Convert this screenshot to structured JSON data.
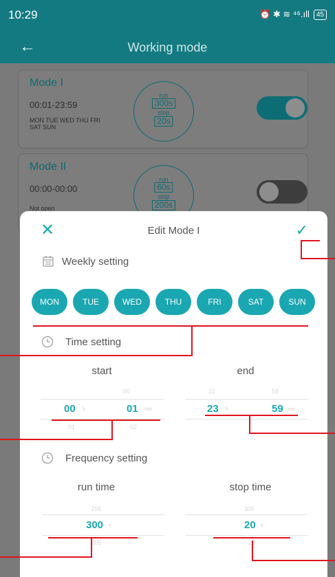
{
  "status_bar": {
    "time": "10:29",
    "icons": "⏰ ✱ ≋ ⁴⁶.ıll",
    "battery": "45"
  },
  "app_bar": {
    "title": "Working mode"
  },
  "modes": [
    {
      "name": "Mode I",
      "time": "00:01-23:59",
      "days": "MON TUE WED THU FRI SAT SUN",
      "run_label": "run",
      "run": "300s",
      "stop_label": "stop",
      "stop": "20s",
      "enabled": true
    },
    {
      "name": "Mode II",
      "time": "00:00-00:00",
      "days": "Not open",
      "run_label": "run",
      "run": "60s",
      "stop_label": "stop",
      "stop": "200s",
      "enabled": false
    }
  ],
  "sheet": {
    "title": "Edit Mode I",
    "weekly_title": "Weekly setting",
    "days": [
      "MON",
      "TUE",
      "WED",
      "THU",
      "FRI",
      "SAT",
      "SUN"
    ],
    "time_title": "Time setting",
    "start_label": "start",
    "end_label": "end",
    "start": {
      "hour": "00",
      "hour_prev": "",
      "hour_next": "01",
      "hour_unit": "h",
      "min": "01",
      "min_prev": "00",
      "min_next": "02",
      "min_unit": "min"
    },
    "end": {
      "hour": "23",
      "hour_prev": "22",
      "hour_next": "",
      "hour_unit": "h",
      "min": "59",
      "min_prev": "58",
      "min_next": "",
      "min_unit": "min"
    },
    "frequency_title": "Frequency setting",
    "run_time_label": "run time",
    "stop_time_label": "stop time",
    "run": {
      "value": "300",
      "prev": "295",
      "next": "305",
      "unit": "s"
    },
    "stop": {
      "value": "20",
      "prev": "300",
      "next": "25",
      "unit": "s"
    }
  },
  "colors": {
    "accent": "#1aa7b1",
    "annotation": "#e0121e",
    "app_bar_dimmed": "#147a81"
  }
}
